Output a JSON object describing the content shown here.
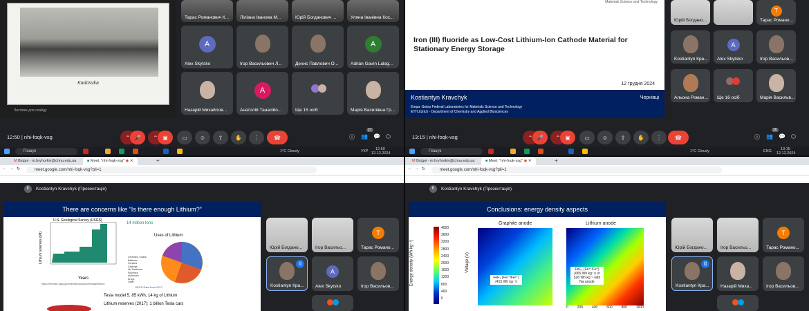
{
  "q1": {
    "slide_caption": "Kadosvka",
    "slide_sub": "Листівка для слайду",
    "clock": "12:50",
    "meeting": "nhi-foqk-vsg",
    "badge_count": "27",
    "tiles": [
      "Тарас Романович К...",
      "Ліліана Іванова М...",
      "Юрій Богданович ...",
      "Уляна Іванівна Кос...",
      "Alex Skytsko",
      "Ігор Васильович Л...",
      "Денис Павлович О...",
      "Adrián Gavín Lalag...",
      "Назарій Михайлов...",
      "Анатолій Танасійо...",
      "Ще 15 осіб",
      "Марія Василівна Гр..."
    ],
    "avatars": {
      "alex": "A",
      "adrian": "A",
      "anatolii": "A"
    },
    "taskbar": {
      "search": "Пошук",
      "weather": "1°C  Cloudy",
      "lang": "УКР",
      "time": "12:50",
      "date": "12.12.2024"
    }
  },
  "q2": {
    "slide_title": "Iron (III) fluoride as Low-Cost Lithium-Ion Cathode Material for Stationary Energy Storage",
    "slide_top": "Materials Science and Technology",
    "slide_date": "12 грудня 2024",
    "presenter": "Kostiantyn Kravchyk",
    "city": "Чернівці",
    "aff1": "Empa -Swiss Federal Laboratories for Materials Science and Technology",
    "aff2": "ETH Zürich - Department of Chemistry and Applied Biosciences",
    "clock": "13:15",
    "meeting": "nhi-foqk-vsg",
    "badge_count": "26",
    "tiles": [
      "Юрій Богдано...",
      "Тарас Романо...",
      "Kostiantyn Кра...",
      "Alex Skytsko",
      "Ігор Васильов...",
      "Альона Роман...",
      "Ще 16 осіб",
      "Марія Васильв..."
    ],
    "avatars": {
      "taras": "T",
      "alex": "A"
    },
    "taskbar": {
      "search": "Пошук",
      "weather": "1°C  Cloudy",
      "lang": "ENG",
      "time": "13:15",
      "date": "12.12.2024"
    }
  },
  "q3": {
    "tab1": "Вхідні - m.hryhorkiv@chnu.edu.ua",
    "tab2": "Meet: \"nhi-foqk-vsg\"",
    "url": "meet.google.com/nhi-foqk-vsg?pli=1",
    "presenter_bar": "Kostiantyn Kravchyk (Презентація)",
    "presenter_initial": "K",
    "slide_title": "There are concerns like “Is there enough Lithium?”",
    "usgs": "U.S. Geological Survey (USGS)",
    "tons": "14 million tons",
    "ylabel": "Lithium reserves (Mt)",
    "xlabel": "Years",
    "pie_title": "Uses of Lithium",
    "usgs_note": "USGS Data from 2017",
    "url_note": "https://minerals.usgs.gov/minerals/pubs/commodity/lithium/",
    "tesla1": "Tesla model 5, 85 kWh, 14 kg of Lithium",
    "tesla2": "Lithium reserves (2017): 1 billion Tesla cars",
    "legend": [
      "Ceramics / Glass",
      "Batteries",
      "Greases",
      "Castings",
      "Air Treatment",
      "Polymers",
      "Aluminum",
      "Drugs",
      "Other"
    ],
    "tiles": [
      "Юрій Богдано...",
      "Ігор Васильо...",
      "Тарас Романо...",
      "Kostiantyn Кра...",
      "Alex Skytsko",
      "Ігор Васильов..."
    ],
    "avatars": {
      "taras": "T",
      "alex": "A"
    }
  },
  "q4": {
    "tab1": "Вхідні - m.hryhorkiv@chnu.edu.ua",
    "tab2": "Meet: \"nhi-foqk-vsg\"",
    "url": "meet.google.com/nhi-foqk-vsg?pli=1",
    "presenter_bar": "Kostiantyn Kravchyk (Презентація)",
    "presenter_initial": "K",
    "slide_title": "Conclusions: energy density aspects",
    "graphite": "Graphite anode",
    "lithium": "Lithium anode",
    "cbar_label": "Energy density (Wh kg⁻¹)",
    "cbar_ticks": [
      "4000",
      "3600",
      "3200",
      "2800",
      "2400",
      "2000",
      "1600",
      "1200",
      "800",
      "400",
      "0"
    ],
    "ylabel": "Voltage (V)",
    "note1": "FeF₃ (Fe³⁺/Fe²⁺) (415 Wh kg⁻¹)",
    "note2": "FeF₃ (Fe³⁺/Fe⁰) (665 Wh kg⁻¹) or 528 Wh kg⁻¹ with Na anode",
    "xticks": [
      "0",
      "200",
      "400",
      "600",
      "800",
      "1000"
    ],
    "tiles": [
      "Юрій Богдано...",
      "Ігор Васильо...",
      "Тарас Романо...",
      "Kostiantyn Кра...",
      "Назарій Миха...",
      "Ігор Васильов..."
    ],
    "avatars": {
      "taras": "T"
    }
  }
}
